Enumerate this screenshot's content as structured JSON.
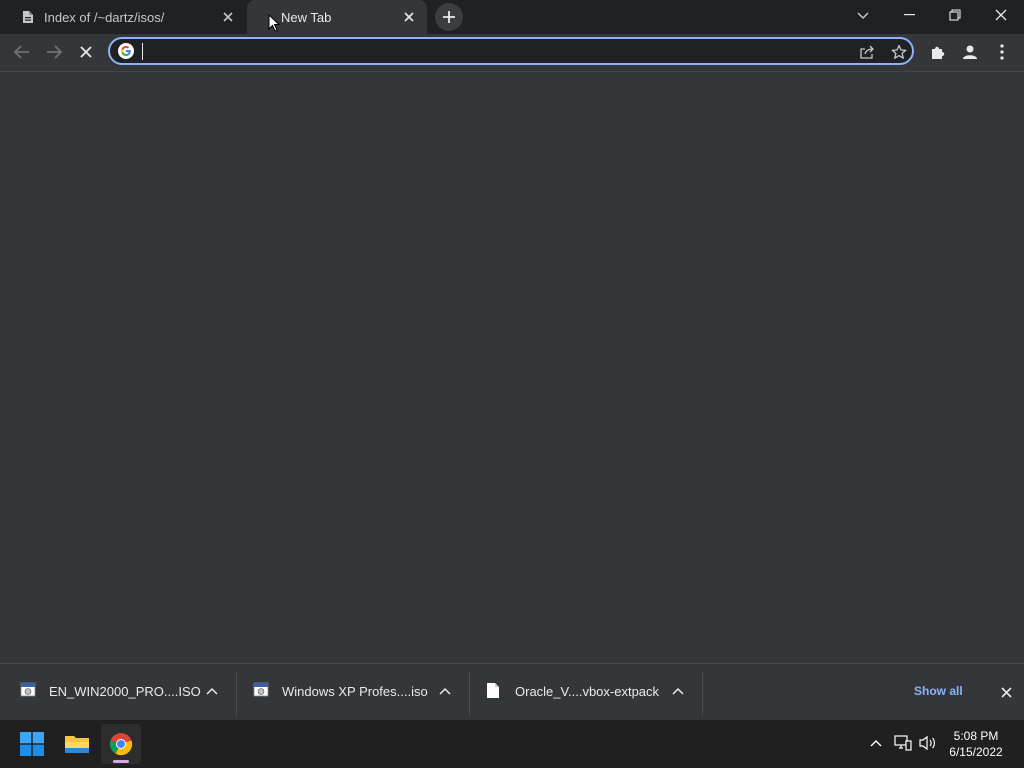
{
  "browser": {
    "tabs": [
      {
        "title": "Index of /~dartz/isos/",
        "active": false,
        "favicon": "web-page-icon"
      },
      {
        "title": "New Tab",
        "active": true,
        "favicon": "loading-spinner-icon"
      }
    ],
    "omnibox": {
      "value": "",
      "placeholder": "",
      "provider_icon": "google-g-icon"
    },
    "accent_color": "#8ab4f8"
  },
  "downloads": {
    "items": [
      {
        "name": "EN_WIN2000_PRO....ISO",
        "icon": "iso-file-icon"
      },
      {
        "name": "Windows XP Profes....iso",
        "icon": "iso-file-icon"
      },
      {
        "name": "Oracle_V....vbox-extpack",
        "icon": "file-icon"
      }
    ],
    "show_all": "Show all"
  },
  "taskbar": {
    "apps": [
      "windows-start-icon",
      "file-explorer-icon",
      "chrome-icon"
    ],
    "clock": {
      "time": "5:08 PM",
      "date": "6/15/2022"
    }
  }
}
